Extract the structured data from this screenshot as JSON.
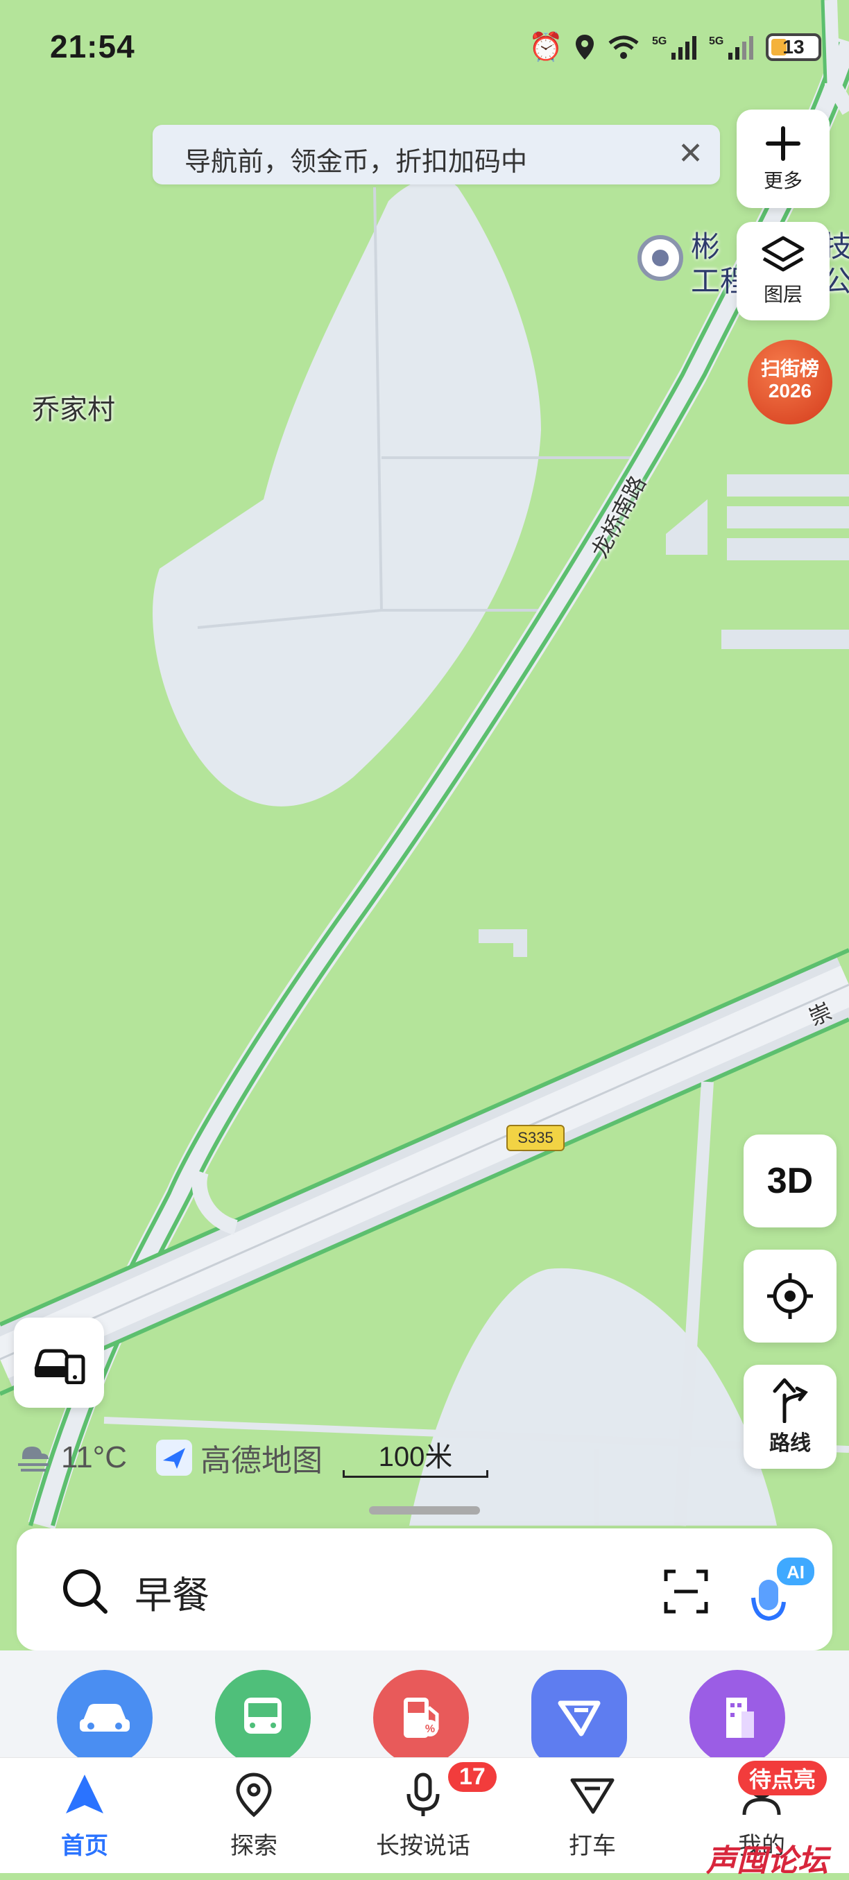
{
  "status_bar": {
    "time": "21:54",
    "battery": "13"
  },
  "banner": {
    "text": "导航前，领金币，折扣加码中"
  },
  "side_buttons": {
    "more_label": "更多",
    "layers_label": "图层",
    "rank_line1": "扫街榜",
    "rank_line2": "2026",
    "three_d": "3D",
    "route_label": "路线"
  },
  "map_labels": {
    "village": "乔家村",
    "poi_line1": "彬",
    "poi_line1b": "技",
    "poi_line2": "工程",
    "poi_line2b": "公",
    "road1": "龙桥南路",
    "road2": "崇",
    "highway": "S335"
  },
  "weather": {
    "temp": "11°C"
  },
  "brand": {
    "name": "高德地图"
  },
  "scale": {
    "label": "100米"
  },
  "search": {
    "query": "早餐",
    "ai_label": "AI"
  },
  "nav": {
    "items": [
      {
        "label": "首页"
      },
      {
        "label": "探索"
      },
      {
        "label": "长按说话"
      },
      {
        "label": "打车"
      },
      {
        "label": "我的"
      }
    ],
    "voice_badge": "17",
    "mine_badge": "待点亮"
  },
  "watermark": "声囤论坛",
  "colors": {
    "accent": "#2a73ff",
    "map_green": "#b4e49a",
    "road": "#5cbf6e"
  }
}
